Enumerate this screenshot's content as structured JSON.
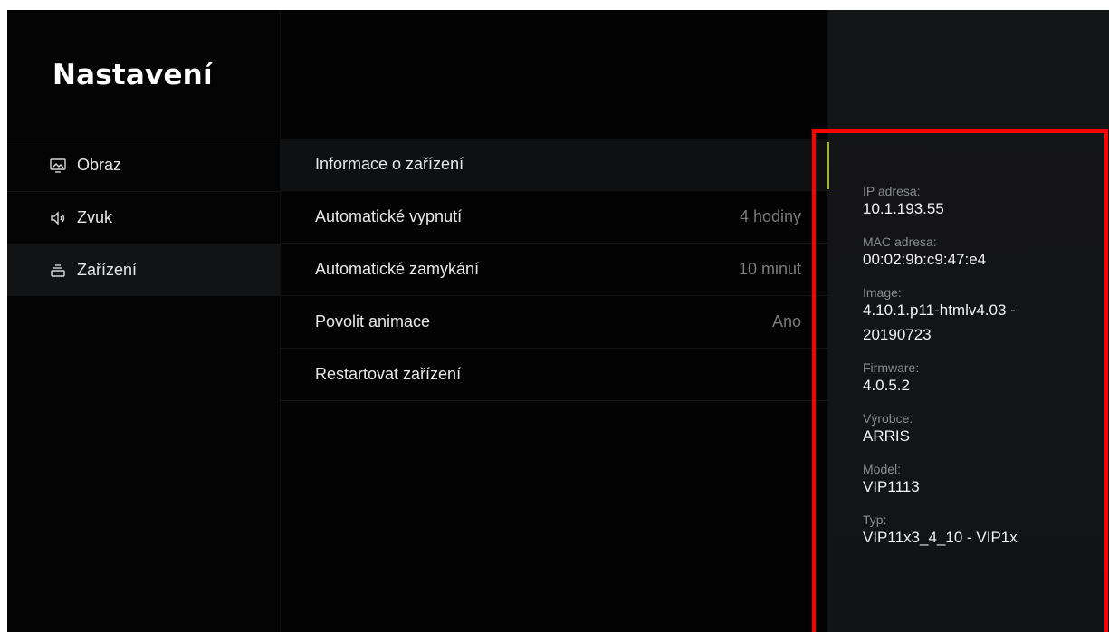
{
  "header": {
    "title": "Nastavení"
  },
  "sidebar": {
    "items": [
      {
        "label": "Obraz",
        "icon": "picture-icon"
      },
      {
        "label": "Zvuk",
        "icon": "speaker-icon"
      },
      {
        "label": "Zařízení",
        "icon": "device-icon",
        "selected": true
      }
    ]
  },
  "settings": {
    "items": [
      {
        "label": "Informace o zařízení",
        "value": "",
        "focused": true
      },
      {
        "label": "Automatické vypnutí",
        "value": "4 hodiny"
      },
      {
        "label": "Automatické zamykání",
        "value": "10 minut"
      },
      {
        "label": "Povolit animace",
        "value": "Ano"
      },
      {
        "label": "Restartovat zařízení",
        "value": ""
      }
    ]
  },
  "device_info": {
    "ip": {
      "label": "IP adresa:",
      "value": "10.1.193.55"
    },
    "mac": {
      "label": "MAC adresa:",
      "value": "00:02:9b:c9:47:e4"
    },
    "image": {
      "label": "Image:",
      "value_line1": "4.10.1.p11-htmlv4.03 -",
      "value_line2": "20190723"
    },
    "firmware": {
      "label": "Firmware:",
      "value": "4.0.5.2"
    },
    "vendor": {
      "label": "Výrobce:",
      "value": "ARRIS"
    },
    "model": {
      "label": "Model:",
      "value": "VIP1113"
    },
    "type": {
      "label": "Typ:",
      "value": "VIP11x3_4_10 - VIP1x"
    }
  },
  "colors": {
    "accent": "#a5b33a",
    "highlight": "#ff0000",
    "background": "#000000"
  }
}
